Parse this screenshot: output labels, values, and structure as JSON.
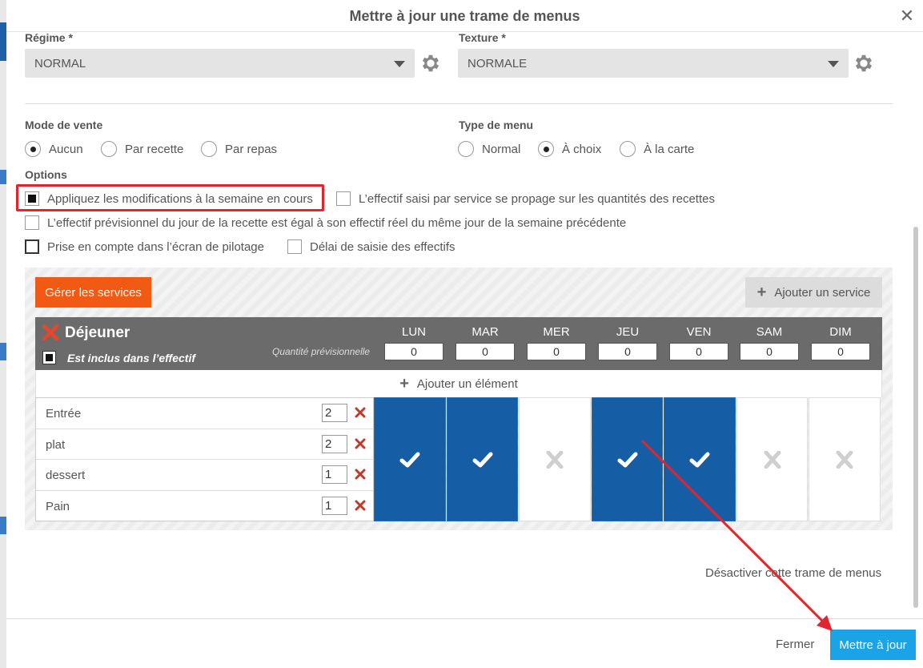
{
  "dialog": {
    "title": "Mettre à jour une trame de menus"
  },
  "regime": {
    "label": "Régime *",
    "value": "NORMAL"
  },
  "texture": {
    "label": "Texture *",
    "value": "NORMALE"
  },
  "mode_vente": {
    "label": "Mode de vente",
    "options": [
      "Aucun",
      "Par recette",
      "Par repas"
    ],
    "selected": "Aucun"
  },
  "type_menu": {
    "label": "Type de menu",
    "options": [
      "Normal",
      "À choix",
      "À la carte"
    ],
    "selected": "À choix"
  },
  "options": {
    "label": "Options",
    "items": [
      {
        "label": "Appliquez les modifications à la semaine en cours",
        "checked": true
      },
      {
        "label": "L’effectif saisi par service se propage sur les quantités des recettes",
        "checked": false
      },
      {
        "label": "L’effectif prévisionnel du jour de la recette est égal à son effectif réel du même jour de la semaine précédente",
        "checked": false
      },
      {
        "label": "Prise en compte dans l’écran de pilotage",
        "checked": false
      },
      {
        "label": "Délai de saisie des effectifs",
        "checked": false
      }
    ]
  },
  "services": {
    "manage_label": "Gérer les services",
    "add_service_label": "Ajouter un service",
    "service": {
      "name": "Déjeuner",
      "included_label": "Est inclus dans l’effectif",
      "qty_label": "Quantité prévisionnelle",
      "days": [
        {
          "name": "LUN",
          "qty": "0",
          "active": true
        },
        {
          "name": "MAR",
          "qty": "0",
          "active": true
        },
        {
          "name": "MER",
          "qty": "0",
          "active": false
        },
        {
          "name": "JEU",
          "qty": "0",
          "active": true
        },
        {
          "name": "VEN",
          "qty": "0",
          "active": true
        },
        {
          "name": "SAM",
          "qty": "0",
          "active": false
        },
        {
          "name": "DIM",
          "qty": "0",
          "active": false
        }
      ],
      "add_element_label": "Ajouter un élément",
      "elements": [
        {
          "label": "Entrée",
          "count": "2"
        },
        {
          "label": "plat",
          "count": "2"
        },
        {
          "label": "dessert",
          "count": "1"
        },
        {
          "label": "Pain",
          "count": "1"
        }
      ]
    }
  },
  "deactivate_label": "Désactiver cette trame de menus",
  "footer": {
    "close_label": "Fermer",
    "update_label": "Mettre à jour"
  },
  "colors": {
    "accent_orange": "#f05a12",
    "primary_blue": "#1ba3e8",
    "day_active": "#155ea6",
    "highlight": "#e0262c"
  }
}
